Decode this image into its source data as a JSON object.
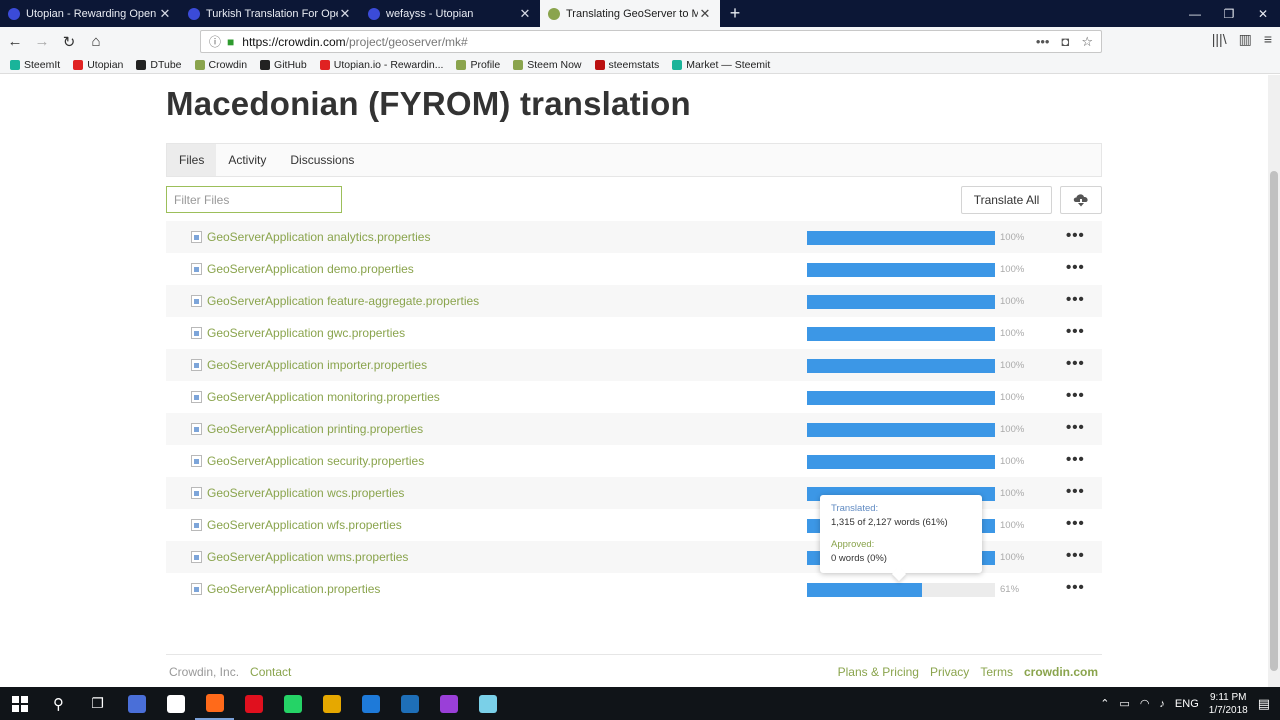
{
  "browser": {
    "tabs": [
      {
        "title": "Utopian - Rewarding Open Sou",
        "color": "#3b4bd8"
      },
      {
        "title": "Turkish Translation For OpenCar",
        "color": "#3b4bd8"
      },
      {
        "title": "wefayss - Utopian",
        "color": "#3b4bd8"
      },
      {
        "title": "Translating GeoServer to Macedo",
        "color": "#8aa44d"
      }
    ],
    "new_tab": "+",
    "url_host": "https://crowdin.com",
    "url_path": "/project/geoserver/mk#",
    "url_more": "•••",
    "bookmarks": [
      {
        "label": "SteemIt",
        "color": "#1ab49a"
      },
      {
        "label": "Utopian",
        "color": "#e02222"
      },
      {
        "label": "DTube",
        "color": "#222"
      },
      {
        "label": "Crowdin",
        "color": "#8aa44d"
      },
      {
        "label": "GitHub",
        "color": "#222"
      },
      {
        "label": "Utopian.io - Rewardin...",
        "color": "#e02222"
      },
      {
        "label": "Profile",
        "color": "#8aa44d"
      },
      {
        "label": "Steem Now",
        "color": "#8aa44d"
      },
      {
        "label": "steemstats",
        "color": "#b11"
      },
      {
        "label": "Market — Steemit",
        "color": "#1ab49a"
      }
    ]
  },
  "page": {
    "title": "Macedonian (FYROM) translation",
    "tabs": [
      "Files",
      "Activity",
      "Discussions"
    ],
    "filter_placeholder": "Filter Files",
    "translate_all": "Translate All",
    "files": [
      {
        "name": "GeoServerApplication analytics.properties",
        "progress": 100,
        "pct": "100%"
      },
      {
        "name": "GeoServerApplication demo.properties",
        "progress": 100,
        "pct": "100%"
      },
      {
        "name": "GeoServerApplication feature-aggregate.properties",
        "progress": 100,
        "pct": "100%"
      },
      {
        "name": "GeoServerApplication gwc.properties",
        "progress": 100,
        "pct": "100%"
      },
      {
        "name": "GeoServerApplication importer.properties",
        "progress": 100,
        "pct": "100%"
      },
      {
        "name": "GeoServerApplication monitoring.properties",
        "progress": 100,
        "pct": "100%"
      },
      {
        "name": "GeoServerApplication printing.properties",
        "progress": 100,
        "pct": "100%"
      },
      {
        "name": "GeoServerApplication security.properties",
        "progress": 100,
        "pct": "100%"
      },
      {
        "name": "GeoServerApplication wcs.properties",
        "progress": 100,
        "pct": "100%"
      },
      {
        "name": "GeoServerApplication wfs.properties",
        "progress": 100,
        "pct": "100%"
      },
      {
        "name": "GeoServerApplication wms.properties",
        "progress": 100,
        "pct": "100%"
      },
      {
        "name": "GeoServerApplication.properties",
        "progress": 61,
        "pct": "61%"
      }
    ],
    "more_dots": "•••",
    "tooltip": {
      "translated_label": "Translated:",
      "translated_value": "1,315 of 2,127 words (61%)",
      "approved_label": "Approved:",
      "approved_value": "0 words (0%)"
    },
    "footer": {
      "company": "Crowdin, Inc.",
      "contact": "Contact",
      "links": [
        "Plans & Pricing",
        "Privacy",
        "Terms"
      ],
      "brand": "crowdin.com"
    }
  },
  "taskbar": {
    "apps": [
      {
        "color": "#4a6fd8"
      },
      {
        "color": "#fff"
      },
      {
        "color": "#ff6a1a"
      },
      {
        "color": "#e0101e"
      },
      {
        "color": "#25d366"
      },
      {
        "color": "#e6a800"
      },
      {
        "color": "#1e7ad9"
      },
      {
        "color": "#1e6fb8"
      },
      {
        "color": "#9a3fd8"
      },
      {
        "color": "#7ad0e8"
      }
    ],
    "lang": "ENG",
    "time": "9:11 PM",
    "date": "1/7/2018"
  }
}
